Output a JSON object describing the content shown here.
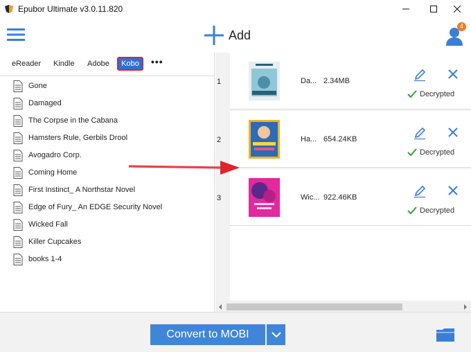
{
  "window": {
    "title": "Epubor Ultimate v3.0.11.820",
    "icon": "epubor-logo-icon",
    "controls": [
      "minimize-icon",
      "maximize-icon",
      "close-icon"
    ]
  },
  "header": {
    "menu_icon": "hamburger-menu-icon",
    "add_label": "Add",
    "add_icon": "plus-icon",
    "user_icon": "user-avatar-icon",
    "notification_count": "4"
  },
  "tabs": [
    {
      "label": "eReader",
      "active": false
    },
    {
      "label": "Kindle",
      "active": false
    },
    {
      "label": "Adobe",
      "active": false
    },
    {
      "label": "Kobo",
      "active": true
    },
    {
      "label": "•••",
      "active": false
    }
  ],
  "library": {
    "books": [
      "Gone",
      "Damaged",
      "The Corpse in the Cabana",
      "Hamsters Rule, Gerbils Drool",
      "Avogadro Corp.",
      "Coming Home",
      "First Instinct_ A Northstar Novel",
      "Edge of Fury_ An EDGE Security Novel",
      "Wicked Fall",
      "Killer Cupcakes",
      "books 1-4"
    ]
  },
  "queue": [
    {
      "index": "1",
      "name": "Da...",
      "size": "2.34MB",
      "status": "Decrypted",
      "cover_colors": [
        "#8fc7d9",
        "#e7edf1"
      ]
    },
    {
      "index": "2",
      "name": "Ha...",
      "size": "654.24KB",
      "status": "Decrypted",
      "cover_colors": [
        "#f0b51f",
        "#2b6bb8"
      ]
    },
    {
      "index": "3",
      "name": "Wic...",
      "size": "922.46KB",
      "status": "Decrypted",
      "cover_colors": [
        "#e12a9d",
        "#5a2a8a"
      ]
    }
  ],
  "bottom": {
    "convert_label": "Convert to MOBI",
    "dropdown_icon": "chevron-down-icon",
    "folder_icon": "folder-icon"
  },
  "colors": {
    "accent": "#3f86d8",
    "tab_active": "#2f6fd6",
    "highlight_border": "#e0242c",
    "success": "#2da334",
    "arrow": "#e0242c"
  }
}
